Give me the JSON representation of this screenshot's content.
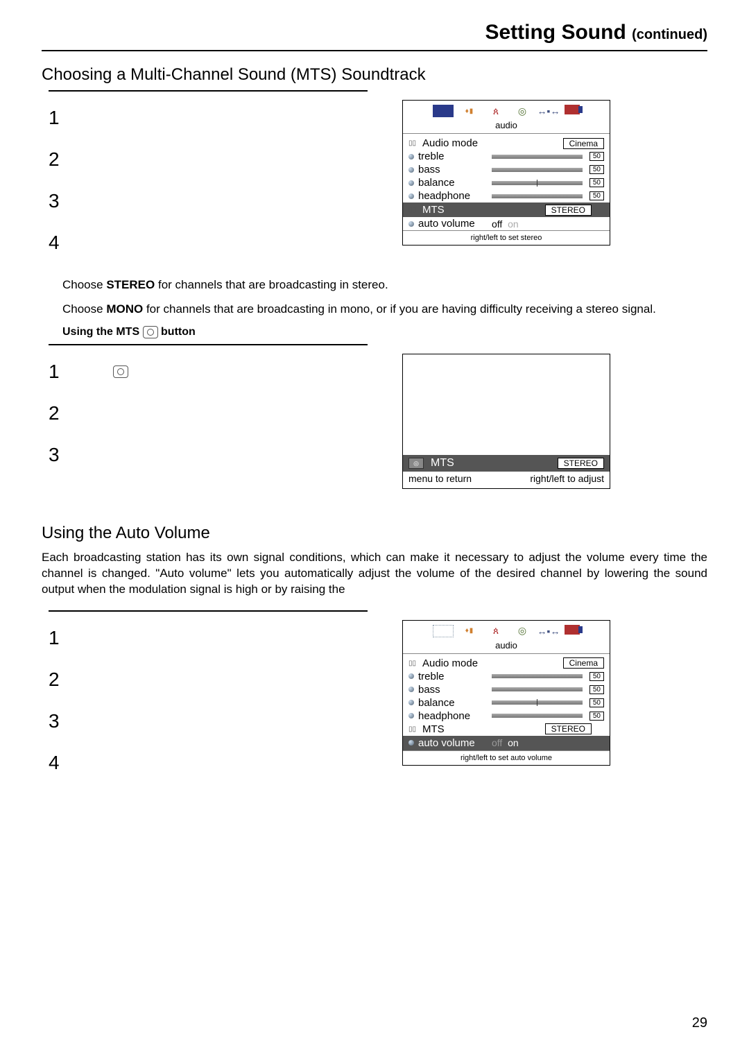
{
  "header": {
    "title": "Setting Sound",
    "continued": "(continued)"
  },
  "section1": {
    "heading": "Choosing a Multi-Channel Sound (MTS) Soundtrack",
    "steps": [
      "1",
      "2",
      "3",
      "4"
    ],
    "note1a": "Choose ",
    "note1b": "STEREO",
    "note1c": " for channels that are broadcasting in stereo.",
    "note2a": "Choose ",
    "note2b": "MONO",
    "note2c": " for channels that are broadcasting in mono, or if you are having difficulty receiving a stereo signal."
  },
  "osd1": {
    "title": "audio",
    "rows": {
      "mode_label": "Audio mode",
      "mode_value": "Cinema",
      "treble": "treble",
      "treble_val": "50",
      "bass": "bass",
      "bass_val": "50",
      "balance": "balance",
      "balance_val": "50",
      "headphone": "headphone",
      "headphone_val": "50",
      "mts": "MTS",
      "mts_val": "STEREO",
      "auto": "auto volume",
      "auto_off": "off",
      "auto_on": "on"
    },
    "footer": "right/left to set stereo"
  },
  "mtsbutton": {
    "heading_a": "Using the MTS ",
    "heading_b": " button",
    "steps": [
      "1",
      "2",
      "3"
    ]
  },
  "osd2": {
    "mts": "MTS",
    "mts_val": "STEREO",
    "foot_left": "menu to return",
    "foot_right": "right/left to adjust"
  },
  "section2": {
    "heading": "Using the Auto Volume",
    "para": "Each broadcasting station has its own signal conditions, which can make it necessary to adjust the volume every time the channel is changed. \"Auto volume\" lets you automatically adjust the volume of the desired channel by lowering the sound output when the modulation signal is high or by raising the",
    "steps": [
      "1",
      "2",
      "3",
      "4"
    ]
  },
  "osd3": {
    "title": "audio",
    "rows": {
      "mode_label": "Audio mode",
      "mode_value": "Cinema",
      "treble": "treble",
      "treble_val": "50",
      "bass": "bass",
      "bass_val": "50",
      "balance": "balance",
      "balance_val": "50",
      "headphone": "headphone",
      "headphone_val": "50",
      "mts": "MTS",
      "mts_val": "STEREO",
      "auto": "auto volume",
      "auto_off": "off",
      "auto_on": "on"
    },
    "footer": "right/left to set auto volume"
  },
  "page": "29"
}
